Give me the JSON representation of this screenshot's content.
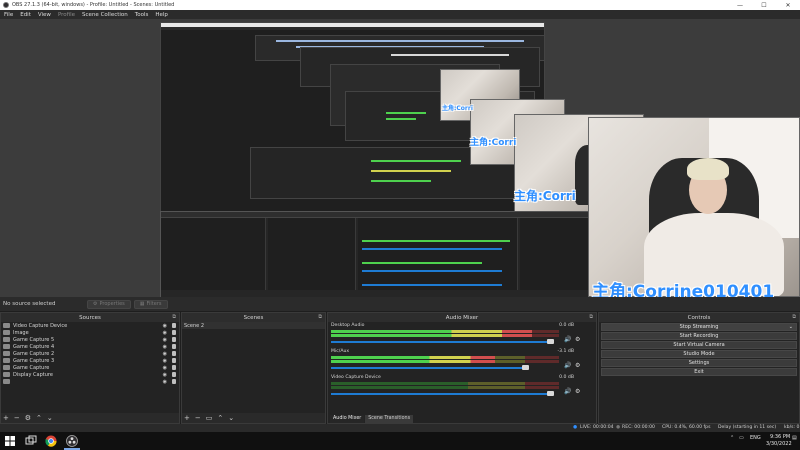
{
  "window": {
    "title": "OBS 27.1.3 (64-bit, windows) - Profile: Untitled - Scenes: Untitled",
    "minimize": "—",
    "maximize": "☐",
    "close": "✕"
  },
  "menu": {
    "items": [
      "File",
      "Edit",
      "View",
      "Profile",
      "Scene Collection",
      "Tools",
      "Help"
    ]
  },
  "preview": {
    "overlay_text": "主角:Corrine010401",
    "overlay_text_short": "主角:Corri"
  },
  "source_bar": {
    "status": "No source selected",
    "properties": "Properties",
    "filters": "Filters"
  },
  "sources": {
    "title": "Sources",
    "items": [
      {
        "name": "Video Capture Device",
        "icon": "camera-icon"
      },
      {
        "name": "Image",
        "icon": "image-icon"
      },
      {
        "name": "Game Capture 5",
        "icon": "gamepad-icon"
      },
      {
        "name": "Game Capture 4",
        "icon": "gamepad-icon"
      },
      {
        "name": "Game Capture 2",
        "icon": "gamepad-icon"
      },
      {
        "name": "Game Capture 3",
        "icon": "gamepad-icon"
      },
      {
        "name": "Game Capture",
        "icon": "gamepad-icon"
      },
      {
        "name": "Display Capture",
        "icon": "monitor-icon"
      },
      {
        "name": "",
        "icon": "gamepad-icon"
      }
    ]
  },
  "scenes": {
    "title": "Scenes",
    "items": [
      "Scene 2"
    ]
  },
  "mixer": {
    "title": "Audio Mixer",
    "channels": [
      {
        "name": "Desktop Audio",
        "db": "0.0 dB",
        "level": 0.88,
        "volume": 0.97
      },
      {
        "name": "Mic/Aux",
        "db": "-3.1 dB",
        "level": 0.72,
        "volume": 0.86
      },
      {
        "name": "Video Capture Device",
        "db": "0.0 dB",
        "level": 0.0,
        "volume": 0.97
      }
    ],
    "tabs": [
      "Audio Mixer",
      "Scene Transitions"
    ]
  },
  "controls": {
    "title": "Controls",
    "buttons": [
      "Stop Streaming",
      "Start Recording",
      "Start Virtual Camera",
      "Studio Mode",
      "Settings",
      "Exit"
    ]
  },
  "status": {
    "live": "LIVE: 00:00:04",
    "rec": "REC: 00:00:00",
    "cpu": "CPU: 0.4%, 60.00 fps",
    "delay": "Delay (starting in 11 sec)",
    "kbs": "kb/s: 0"
  },
  "taskbar": {
    "lang": "ENG",
    "time": "9:36 PM",
    "date": "3/30/2022"
  },
  "colors": {
    "accent_blue": "#1e7bd3",
    "overlay_blue": "#2f8fff"
  }
}
